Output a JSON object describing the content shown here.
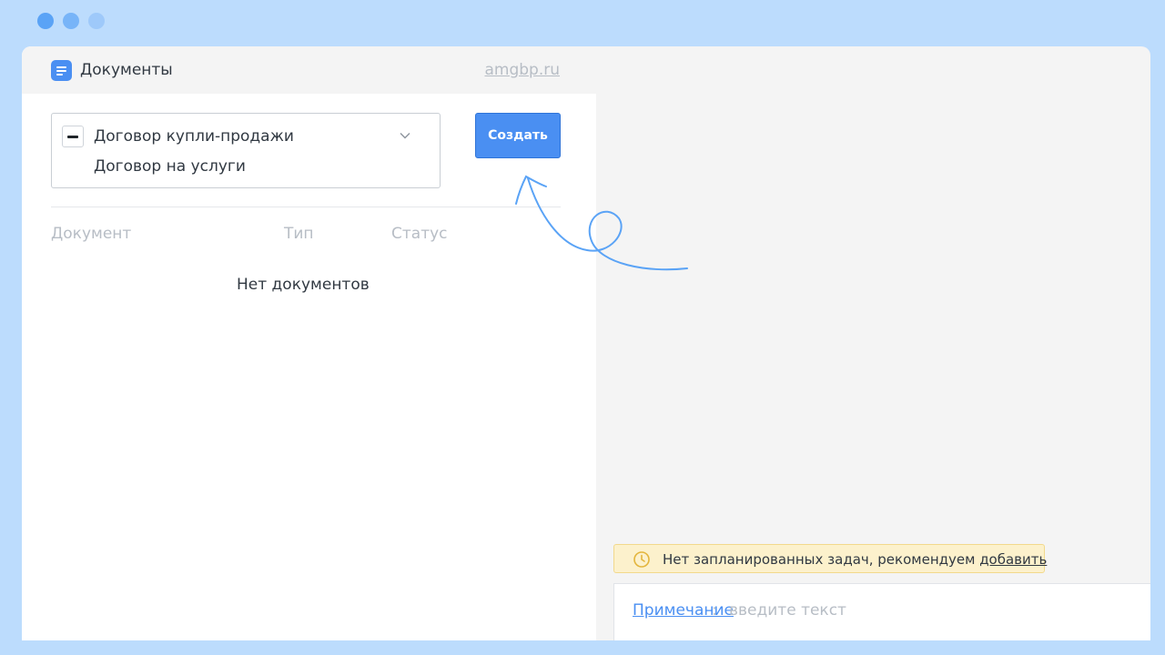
{
  "browser": {
    "dot_colors": [
      "#5aa3f6",
      "#77b4f8",
      "#9ec9fa"
    ]
  },
  "documents_panel": {
    "title": "Документы",
    "title_icon": "document-icon",
    "site_link": "amgbp.ru",
    "type_select": {
      "options": [
        "Договор купли-продажи",
        "Договор на услуги"
      ],
      "toggle_icon": "minus-icon",
      "dropdown_icon": "chevron-down-icon"
    },
    "create_button": "Создать",
    "table": {
      "columns": [
        "Документ",
        "Тип",
        "Статус"
      ],
      "empty_message": "Нет документов"
    }
  },
  "task_banner": {
    "icon": "clock-icon",
    "text": "Нет запланированных задач, рекомендуем ",
    "link": "добавить"
  },
  "note": {
    "label": "Примечание",
    "separator": ":",
    "placeholder": "введите текст"
  },
  "colors": {
    "accent": "#4a8ff2",
    "hint_arrow": "#5aa3f6",
    "banner_bg": "#fcf1cc",
    "muted_text": "#b7bdc5"
  }
}
